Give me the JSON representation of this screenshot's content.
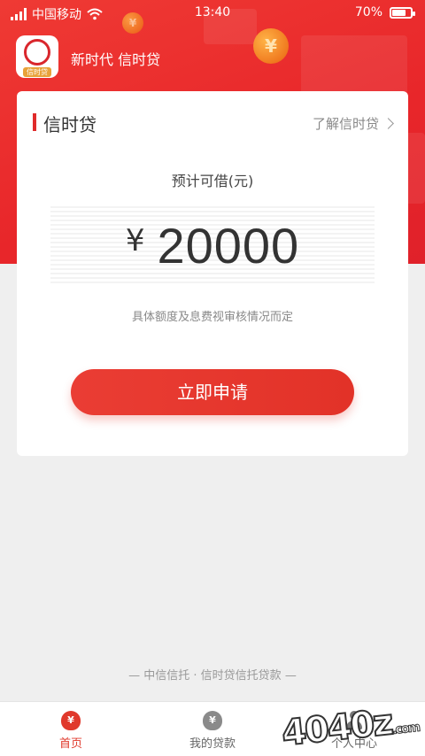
{
  "status_bar": {
    "carrier": "中国移动",
    "time": "13:40",
    "battery": "70%",
    "battery_level": 0.7
  },
  "app": {
    "logo_tag": "信时贷",
    "title": "新时代 信时贷"
  },
  "hero": {
    "coin_symbol": "¥"
  },
  "card": {
    "title": "信时贷",
    "more_link": "了解信时贷",
    "estimate_label": "预计可借(元)",
    "currency_symbol": "¥",
    "amount": "20000",
    "note": "具体额度及息费视审核情况而定",
    "apply_button": "立即申请"
  },
  "footer_text": "— 中信信托 · 信时贷信托贷款 —",
  "tabbar": {
    "tabs": [
      {
        "label": "首页",
        "icon": "home-moneybag-icon",
        "active": true
      },
      {
        "label": "我的贷款",
        "icon": "loan-bag-icon",
        "active": false
      },
      {
        "label": "个人中心",
        "icon": "person-icon",
        "active": false
      }
    ],
    "active_color": "#e0392c"
  },
  "watermark": {
    "text": "4040z",
    "suffix": ".com"
  },
  "colors": {
    "brand_red": "#e8262a",
    "button_red": "#e23228"
  }
}
